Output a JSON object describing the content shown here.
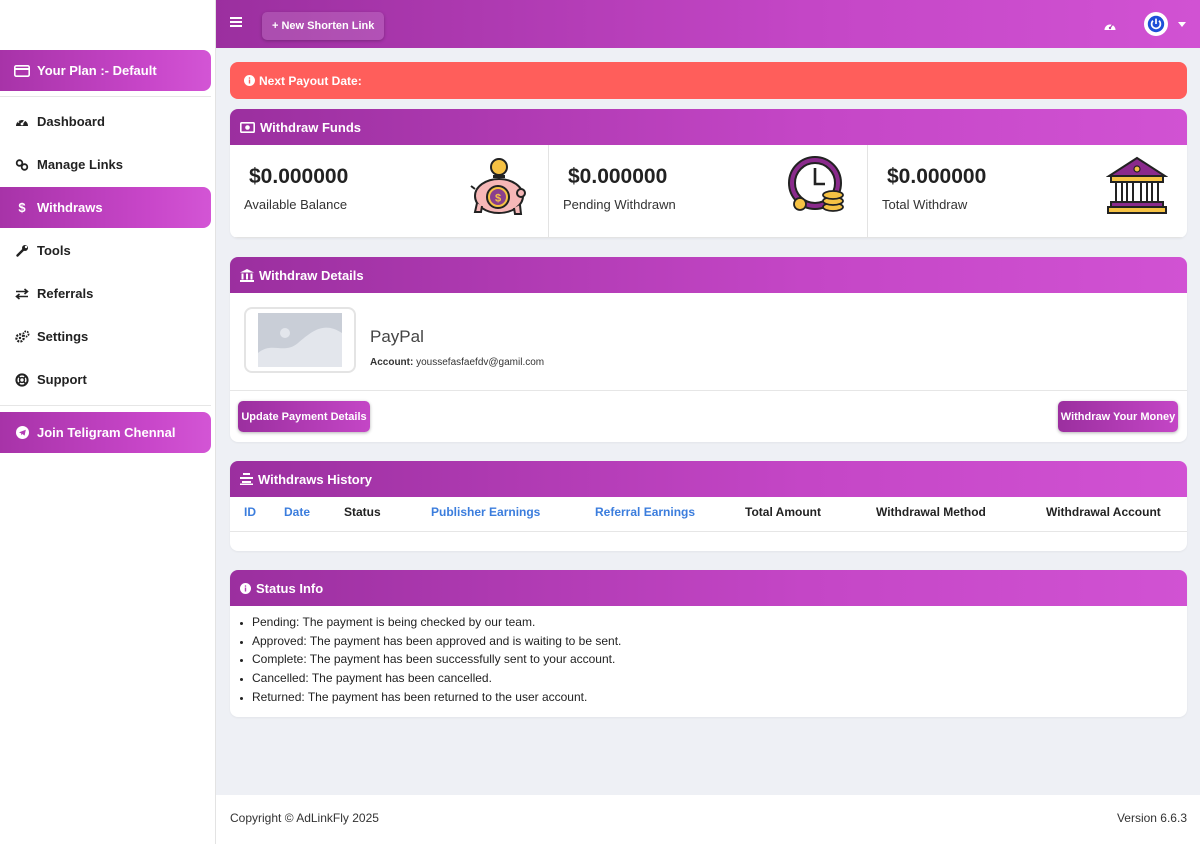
{
  "sidebar": {
    "plan_label": "Your Plan :- Default",
    "items": [
      {
        "label": "Dashboard"
      },
      {
        "label": "Manage Links"
      },
      {
        "label": "Withdraws"
      },
      {
        "label": "Tools"
      },
      {
        "label": "Referrals"
      },
      {
        "label": "Settings"
      },
      {
        "label": "Support"
      }
    ],
    "telegram_label": "Join Teligram Chennal"
  },
  "topbar": {
    "new_link_label": "+ New Shorten Link",
    "icons": [
      "menu-icon",
      "gauge-icon",
      "power-icon",
      "caret-down-icon"
    ]
  },
  "alert": {
    "text": "Next Payout Date:"
  },
  "withdraw_funds": {
    "title": "Withdraw Funds",
    "stats": [
      {
        "amount": "$0.000000",
        "label": "Available Balance",
        "icon": "piggy-bank-icon"
      },
      {
        "amount": "$0.000000",
        "label": "Pending Withdrawn",
        "icon": "clock-coins-icon"
      },
      {
        "amount": "$0.000000",
        "label": "Total Withdraw",
        "icon": "bank-icon"
      }
    ]
  },
  "withdraw_details": {
    "title": "Withdraw Details",
    "method": "PayPal",
    "account_label": "Account:",
    "account_value": "youssefasfaefdv@gamil.com",
    "update_button": "Update Payment Details",
    "withdraw_button": "Withdraw Your Money"
  },
  "history": {
    "title": "Withdraws History",
    "columns": [
      "ID",
      "Date",
      "Status",
      "Publisher Earnings",
      "Referral Earnings",
      "Total Amount",
      "Withdrawal Method",
      "Withdrawal Account"
    ]
  },
  "status_info": {
    "title": "Status Info",
    "items": [
      "Pending: The payment is being checked by our team.",
      "Approved: The payment has been approved and is waiting to be sent.",
      "Complete: The payment has been successfully sent to your account.",
      "Cancelled: The payment has been cancelled.",
      "Returned: The payment has been returned to the user account."
    ]
  },
  "footer": {
    "copyright": "Copyright © AdLinkFly 2025",
    "version": "Version 6.6.3"
  },
  "colors": {
    "accent": "#b23cb4",
    "alert": "#ff5e5b",
    "link": "#3b7ddd"
  }
}
